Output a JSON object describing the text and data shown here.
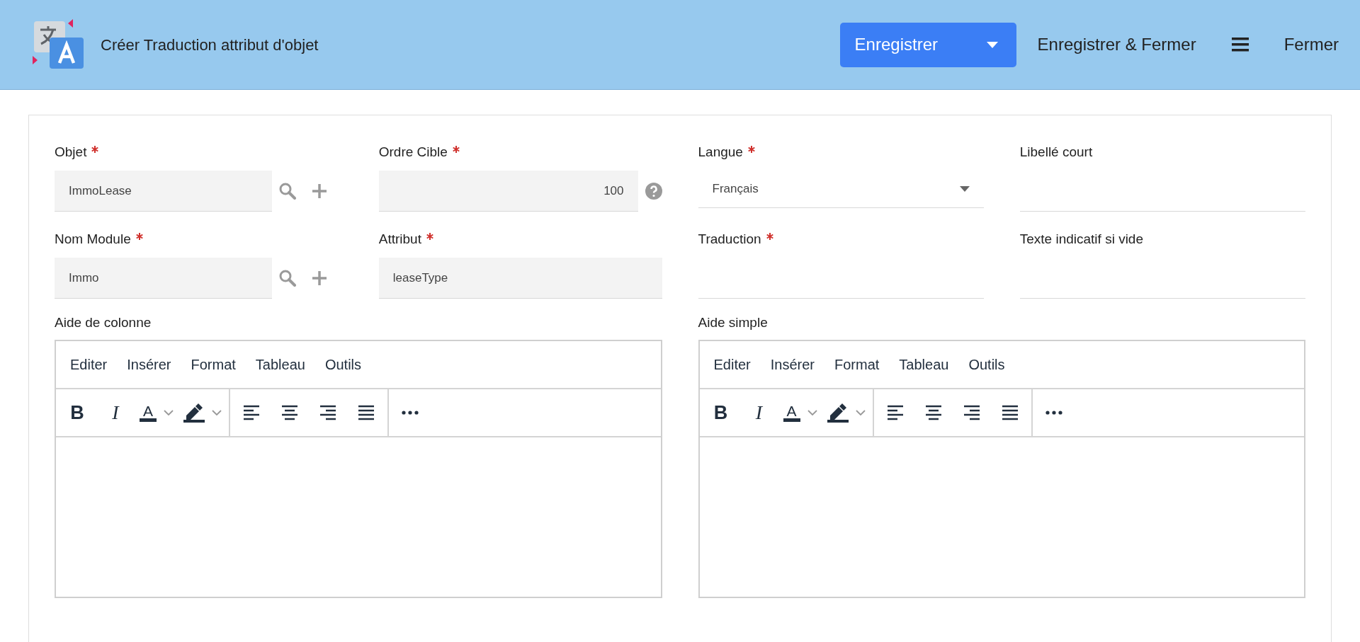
{
  "header": {
    "title": "Créer Traduction attribut d'objet",
    "actions": [
      {
        "kind": "split",
        "label": "Enregistrer"
      },
      {
        "kind": "text",
        "label": "Enregistrer & Fermer"
      },
      {
        "kind": "menu"
      },
      {
        "kind": "text",
        "label": "Fermer"
      }
    ]
  },
  "fields": [
    {
      "label": "Objet",
      "required": true,
      "kind": "lookup",
      "value": "ImmoLease"
    },
    {
      "label": "Ordre Cible",
      "required": true,
      "kind": "help",
      "value": "100"
    },
    {
      "label": "Langue",
      "required": true,
      "kind": "select",
      "value": "Français"
    },
    {
      "label": "Libellé court",
      "required": false,
      "kind": "line"
    },
    {
      "label": "Nom Module",
      "required": true,
      "kind": "lookup",
      "value": "Immo"
    },
    {
      "label": "Attribut",
      "required": true,
      "kind": "filled",
      "value": "leaseType"
    },
    {
      "label": "Traduction",
      "required": true,
      "kind": "line"
    },
    {
      "label": "Texte indicatif si vide",
      "required": false,
      "kind": "line"
    }
  ],
  "editors": [
    {
      "label": "Aide de colonne",
      "menu": [
        "Editer",
        "Insérer",
        "Format",
        "Tableau",
        "Outils"
      ],
      "toolbar": [
        [
          {
            "kind": "bold",
            "glyph": "B"
          },
          {
            "kind": "italic",
            "glyph": "I"
          },
          {
            "kind": "text-color",
            "glyph": "A"
          },
          {
            "kind": "highlight"
          }
        ],
        [
          {
            "kind": "align-left"
          },
          {
            "kind": "align-center"
          },
          {
            "kind": "align-right"
          },
          {
            "kind": "justify"
          }
        ],
        [
          {
            "kind": "more"
          }
        ]
      ]
    },
    {
      "label": "Aide simple",
      "menu": [
        "Editer",
        "Insérer",
        "Format",
        "Tableau",
        "Outils"
      ],
      "toolbar": [
        [
          {
            "kind": "bold",
            "glyph": "B"
          },
          {
            "kind": "italic",
            "glyph": "I"
          },
          {
            "kind": "text-color",
            "glyph": "A"
          },
          {
            "kind": "highlight"
          }
        ],
        [
          {
            "kind": "align-left"
          },
          {
            "kind": "align-center"
          },
          {
            "kind": "align-right"
          },
          {
            "kind": "justify"
          }
        ],
        [
          {
            "kind": "more"
          }
        ]
      ]
    }
  ]
}
